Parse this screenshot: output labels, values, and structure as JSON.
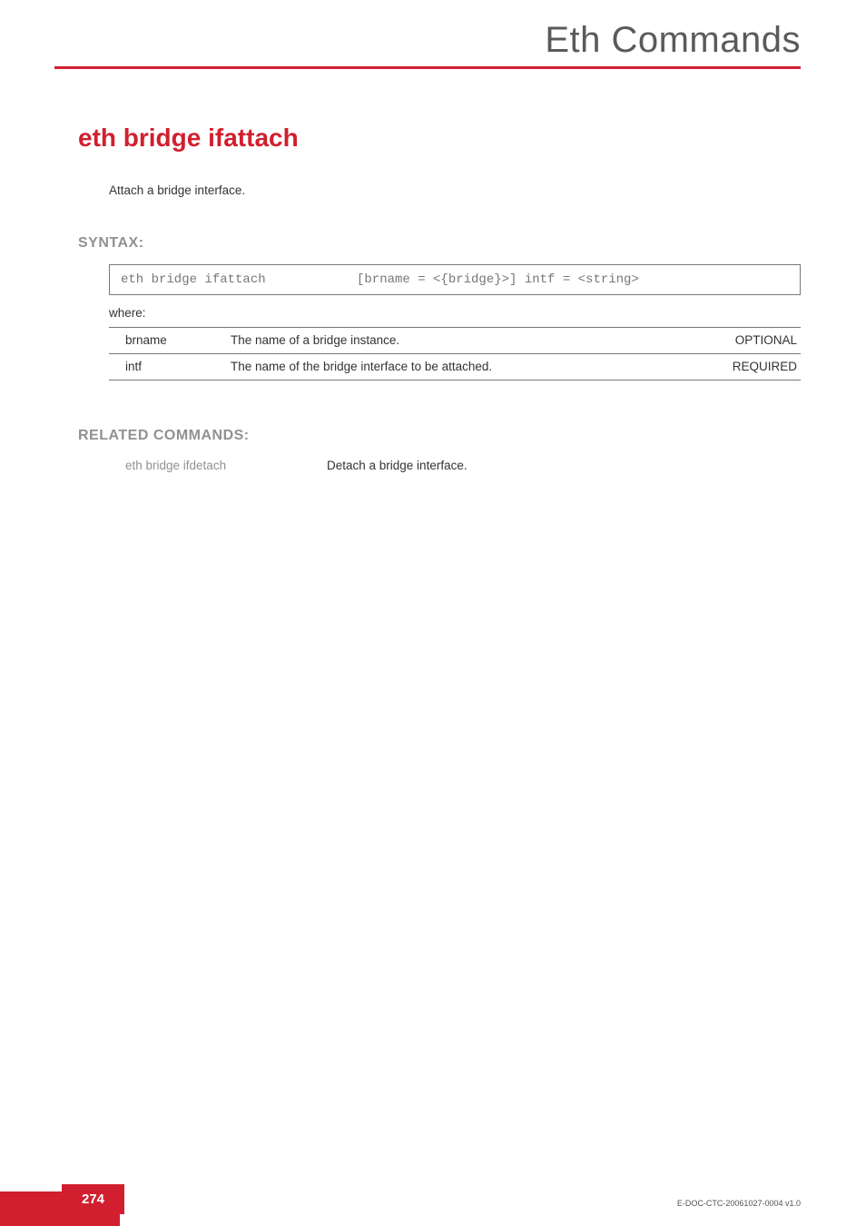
{
  "chapter": {
    "title": "Eth Commands"
  },
  "command": {
    "title": "eth bridge ifattach",
    "intro": "Attach a bridge interface."
  },
  "syntax": {
    "heading": "SYNTAX:",
    "cmd": "eth bridge ifattach",
    "args": "[brname = <{bridge}>] intf = <string>",
    "where": "where:",
    "params": [
      {
        "name": "brname",
        "desc": "The name of  a bridge instance.",
        "req": "OPTIONAL"
      },
      {
        "name": "intf",
        "desc": "The name of the bridge interface to be attached.",
        "req": "REQUIRED"
      }
    ]
  },
  "related": {
    "heading": "RELATED COMMANDS:",
    "items": [
      {
        "link": "eth bridge ifdetach",
        "desc": "Detach a bridge interface."
      }
    ]
  },
  "footer": {
    "pagenum": "274",
    "docid": "E-DOC-CTC-20061027-0004 v1.0"
  }
}
